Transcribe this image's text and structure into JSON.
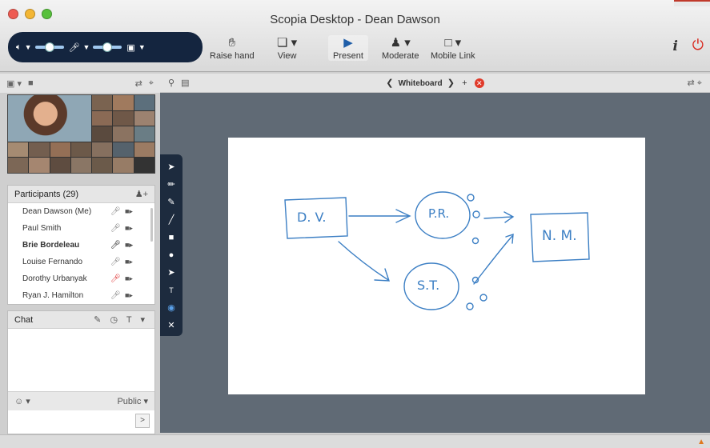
{
  "window": {
    "title": "Scopia Desktop - Dean Dawson"
  },
  "toolbar": {
    "raise_hand": "Raise hand",
    "view": "View",
    "present": "Present",
    "moderate": "Moderate",
    "mobile_link": "Mobile Link",
    "speaker_volume": 0.4,
    "mic_volume": 0.4
  },
  "participants": {
    "header": "Participants (29)",
    "list": [
      {
        "name": "Dean Dawson (Me)",
        "bold": false,
        "muted": false
      },
      {
        "name": "Paul Smith",
        "bold": false,
        "muted": false
      },
      {
        "name": "Brie Bordeleau",
        "bold": true,
        "muted": false
      },
      {
        "name": "Louise Fernando",
        "bold": false,
        "muted": false
      },
      {
        "name": "Dorothy Urbanyak",
        "bold": false,
        "muted": true
      },
      {
        "name": "Ryan J. Hamilton",
        "bold": false,
        "muted": false
      }
    ]
  },
  "chat": {
    "header": "Chat",
    "icons": "✎ ◷ T ▾",
    "emoji": "☺ ▾",
    "audience": "Public ▾",
    "send": ">"
  },
  "whiteboard": {
    "title": "Whiteboard",
    "nodes": [
      "D. V.",
      "P.R.",
      "S.T.",
      "N. M."
    ]
  },
  "colors": {
    "accent": "#1f5ea8",
    "ink": "#3c7fc4",
    "close": "#e03a2a",
    "power": "#d8261c"
  }
}
